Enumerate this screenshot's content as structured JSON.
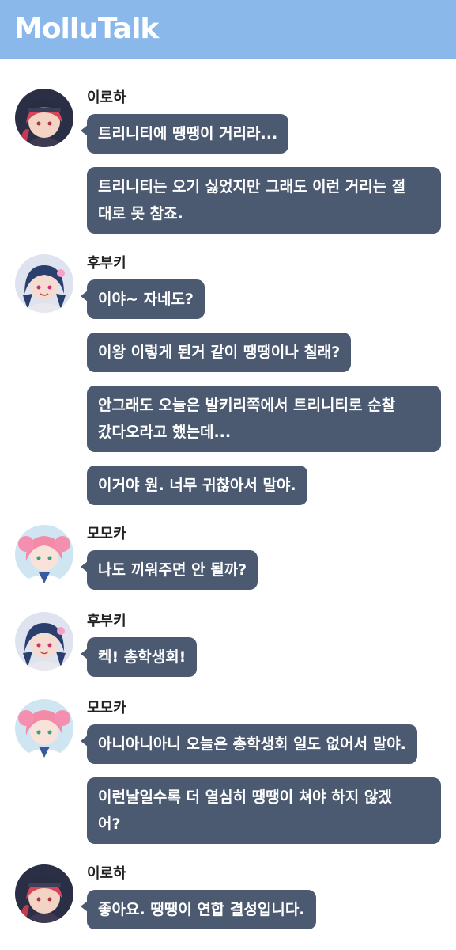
{
  "app": {
    "title": "MolluTalk"
  },
  "chat": {
    "groups": [
      {
        "name": "이로하",
        "avatar": "iroha-avatar",
        "messages": [
          "트리니티에 땡땡이 거리라...",
          "트리니티는 오기 싫었지만 그래도 이런 거리는 절\n대로 못 참죠."
        ]
      },
      {
        "name": "후부키",
        "avatar": "fubuki-avatar",
        "messages": [
          "이야~ 자네도?",
          "이왕 이렇게 된거 같이 땡땡이나 칠래?",
          "안그래도 오늘은 발키리쪽에서 트리니티로 순찰\n갔다오라고 했는데...",
          "이거야 원. 너무 귀찮아서 말야."
        ]
      },
      {
        "name": "모모카",
        "avatar": "momoka-avatar",
        "messages": [
          "나도 끼워주면 안 될까?"
        ]
      },
      {
        "name": "후부키",
        "avatar": "fubuki-avatar",
        "messages": [
          "켁! 총학생회!"
        ]
      },
      {
        "name": "모모카",
        "avatar": "momoka-avatar",
        "messages": [
          "아니아니아니 오늘은 총학생회 일도 없어서 말야.",
          "이런날일수록 더 열심히 땡땡이 쳐야 하지 않겠\n어?"
        ]
      },
      {
        "name": "이로하",
        "avatar": "iroha-avatar",
        "messages": [
          "좋아요. 땡땡이 연합 결성입니다."
        ]
      }
    ]
  }
}
